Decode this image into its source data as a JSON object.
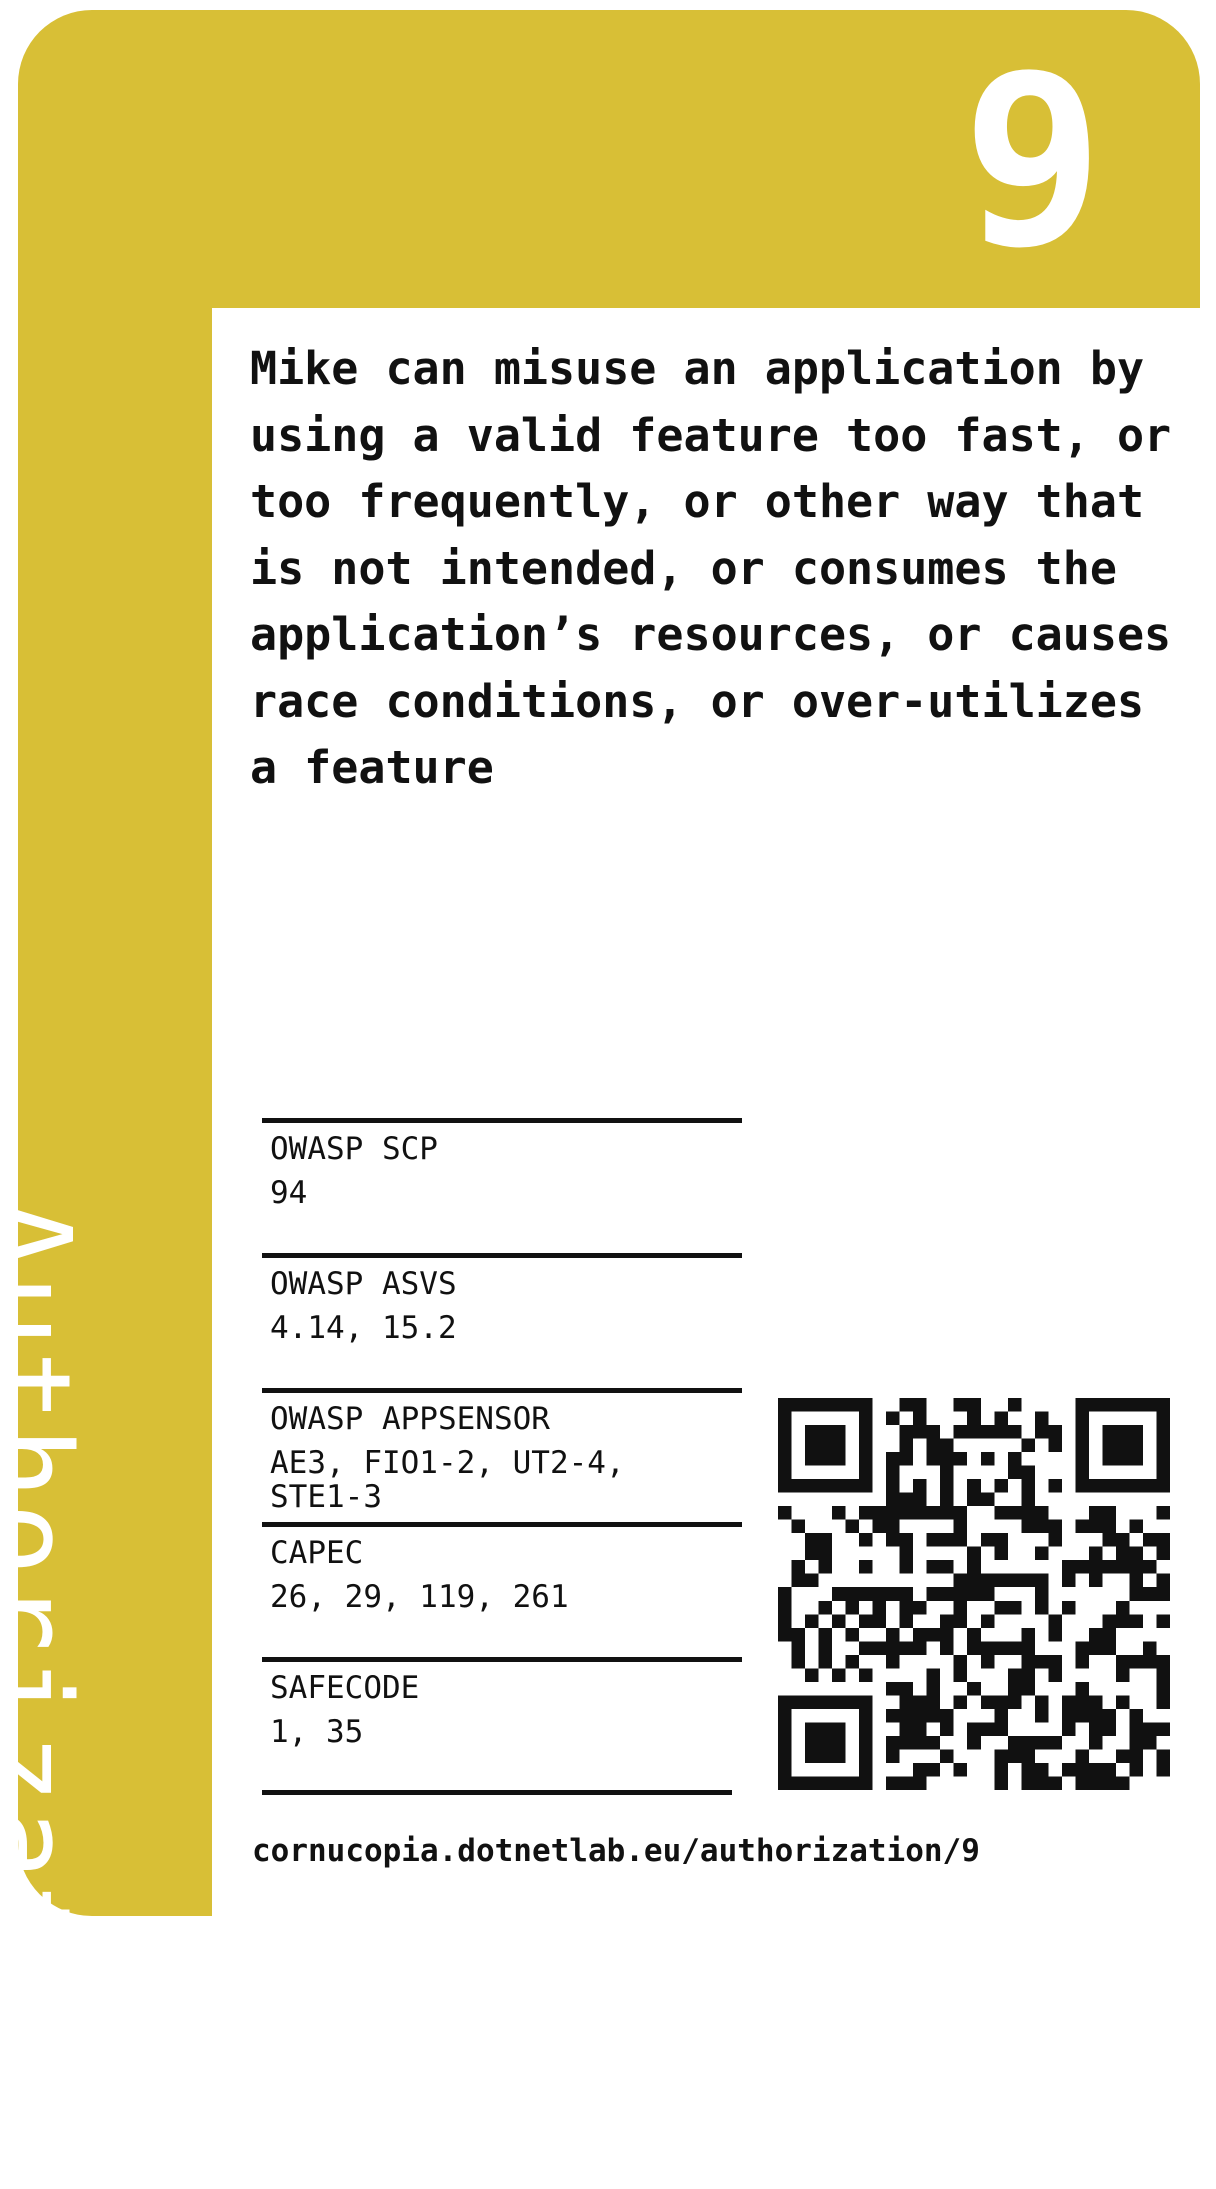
{
  "card": {
    "suit": "Authorization",
    "number": "9",
    "description": "Mike can misuse an application by using a valid feature too fast, or too frequently, or other way that is not intended, or consumes the application’s resources, or causes race conditions, or over-utilizes a feature",
    "url": "cornucopia.dotnetlab.eu/authorization/9",
    "colors": {
      "suit_color": "#d8bf36",
      "text": "#111111",
      "panel": "#ffffff"
    }
  },
  "mappings": [
    {
      "label": "OWASP SCP",
      "value": "94"
    },
    {
      "label": "OWASP ASVS",
      "value": "4.14, 15.2"
    },
    {
      "label": "OWASP APPSENSOR",
      "value": "AE3, FIO1-2, UT2-4,\nSTE1-3"
    },
    {
      "label": "CAPEC",
      "value": "26, 29, 119, 261"
    },
    {
      "label": "SAFECODE",
      "value": "1, 35"
    }
  ],
  "qr_code": {
    "icon": "qr-code-icon"
  }
}
